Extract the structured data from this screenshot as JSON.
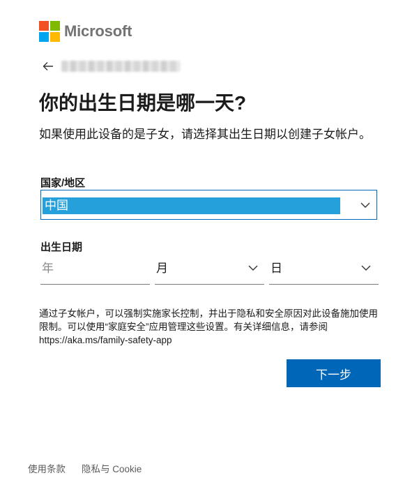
{
  "brand": {
    "name": "Microsoft",
    "colors": [
      "#f25022",
      "#7fba00",
      "#00a4ef",
      "#ffb900"
    ]
  },
  "back": {
    "icon": "back-arrow-icon"
  },
  "identity": {
    "text": ""
  },
  "title": "你的出生日期是哪一天?",
  "description": "如果使用此设备的是子女，请选择其出生日期以创建子女帐户。",
  "country": {
    "label": "国家/地区",
    "selected": "中国",
    "icon": "chevron-down-icon"
  },
  "dob": {
    "label": "出生日期",
    "year_placeholder": "年",
    "month_value": "月",
    "day_value": "日"
  },
  "note": "通过子女帐户，可以强制实施家长控制，并出于隐私和安全原因对此设备施加使用限制。可以使用“家庭安全”应用管理这些设置。有关详细信息，请参阅 https://aka.ms/family-safety-app",
  "next_button": "下一步",
  "footer": {
    "terms": "使用条款",
    "privacy": "隐私与 Cookie"
  },
  "colors": {
    "accent": "#0067b8",
    "selection": "#26a0da"
  }
}
